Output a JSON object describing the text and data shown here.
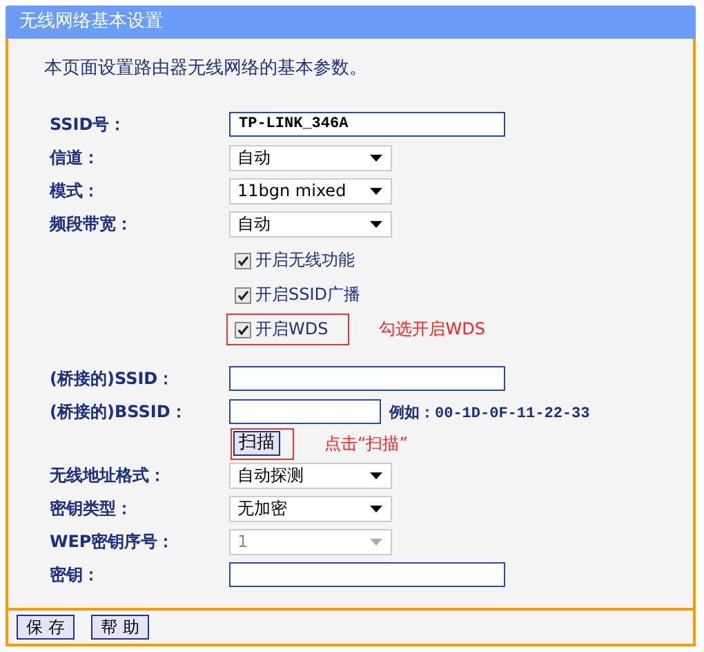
{
  "window": {
    "title": "无线网络基本设置"
  },
  "description": "本页面设置路由器无线网络的基本参数。",
  "fields": [
    {
      "kind": "text",
      "label": "SSID号：",
      "value": "TP-LINK_346A",
      "disabled": false
    },
    {
      "kind": "select",
      "label": "信道：",
      "value": "自动",
      "disabled": false
    },
    {
      "kind": "select",
      "label": "模式：",
      "value": "11bgn mixed",
      "disabled": false
    },
    {
      "kind": "select",
      "label": "频段带宽：",
      "value": "自动",
      "disabled": false
    }
  ],
  "options": [
    {
      "label": "开启无线功能",
      "checked": true,
      "highlighted": false
    },
    {
      "label": "开启SSID广播",
      "checked": true,
      "highlighted": false
    },
    {
      "label": "开启WDS",
      "checked": true,
      "highlighted": true,
      "annotation": "勾选开启WDS"
    }
  ],
  "bridge": [
    {
      "kind": "text",
      "label": "(桥接的)SSID：",
      "disabled": false
    },
    {
      "kind": "short",
      "label": "(桥接的)BSSID：",
      "hint": "例如：00-1D-0F-11-22-33",
      "disabled": false
    }
  ],
  "scan_button": {
    "label": "扫描",
    "highlighted": true,
    "annotation": "点击“扫描”"
  },
  "security": [
    {
      "kind": "select",
      "label": "无线地址格式：",
      "value": "自动探测",
      "disabled": false
    },
    {
      "kind": "select",
      "label": "密钥类型：",
      "value": "无加密",
      "disabled": false
    },
    {
      "kind": "select",
      "label": "WEP密钥序号：",
      "value": "1",
      "disabled": true
    },
    {
      "kind": "text",
      "label": "密钥：",
      "disabled": false
    }
  ],
  "buttons": [
    "保 存",
    "帮 助"
  ]
}
